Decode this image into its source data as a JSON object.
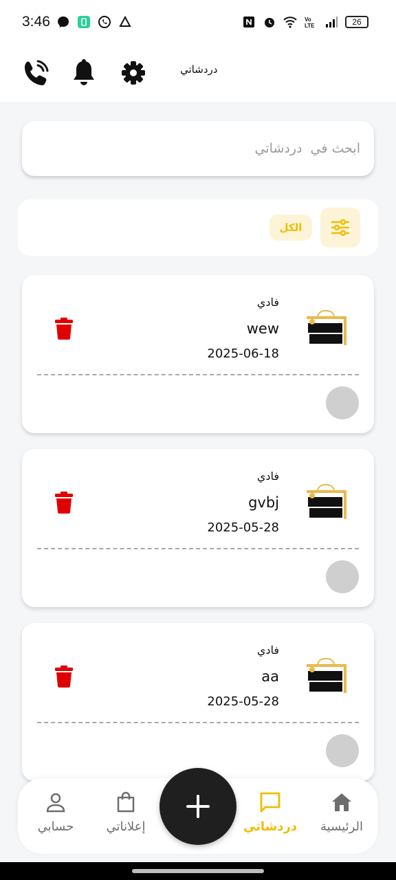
{
  "status_bar": {
    "time": "3:46",
    "battery": "26",
    "left_icons": [
      "messenger-icon",
      "app-icon",
      "whatsapp-icon",
      "alert-icon"
    ],
    "right_icons": [
      "nfc-icon",
      "alarm-icon",
      "wifi-icon",
      "volte-icon",
      "signal-icon",
      "battery-icon"
    ]
  },
  "app_bar": {
    "title": "دردشاتي",
    "icons": [
      "phone-call-icon",
      "bell-icon",
      "settings-icon"
    ]
  },
  "search": {
    "placeholder": "ابحث في  دردشاتي",
    "value": ""
  },
  "filter": {
    "all_label": "الكل",
    "icon": "sliders-icon"
  },
  "chats": [
    {
      "name": "فادي",
      "message": "wew",
      "date": "2025-06-18"
    },
    {
      "name": "فادي",
      "message": "gvbj",
      "date": "2025-05-28"
    },
    {
      "name": "فادي",
      "message": "aa",
      "date": "2025-05-28"
    }
  ],
  "bottom_nav": {
    "items": [
      {
        "label": "حسابي",
        "icon": "user-icon",
        "active": false
      },
      {
        "label": "إعلاناتي",
        "icon": "shopping-bag-icon",
        "active": false
      },
      {
        "label": "دردشاتي",
        "icon": "chat-icon",
        "active": true
      },
      {
        "label": "الرئيسية",
        "icon": "home-icon",
        "active": false
      }
    ],
    "fab_icon": "plus-icon"
  },
  "colors": {
    "accent": "#f0bd00",
    "accent_light": "#fdf4d8",
    "delete": "#e00000",
    "background": "#f5f6f8"
  }
}
